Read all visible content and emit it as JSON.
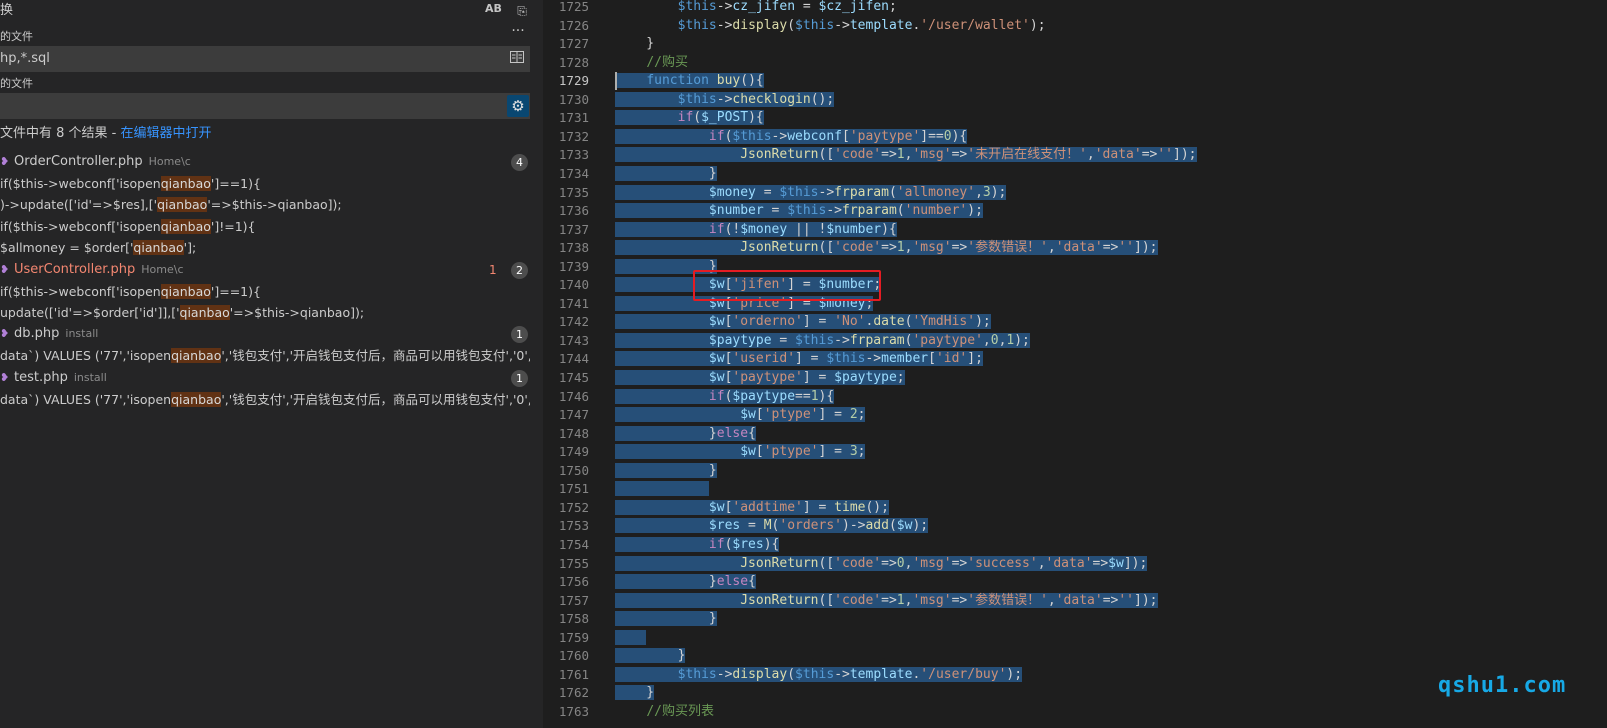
{
  "search": {
    "replace_label": "换",
    "replace_ab": "AB",
    "more": "···",
    "include_label": "的文件",
    "include_value": "hp,*.sql",
    "exclude_label": "的文件",
    "exclude_value": "",
    "summary_text": "文件中有 8 个结果 - ",
    "summary_link": "在编辑器中打开"
  },
  "results": [
    {
      "file": "OrderController.php",
      "path": "Home\\c",
      "count": "4",
      "error": false,
      "problems": "",
      "matches": [
        {
          "pre": "if($this->webconf['isopen",
          "hit": "qianbao",
          "post": "']==1){"
        },
        {
          "pre": ")->update(['id'=>$res],['",
          "hit": "qianbao",
          "post": "'=>$this->qianbao]);"
        },
        {
          "pre": "if($this->webconf['isopen",
          "hit": "qianbao",
          "post": "']!=1){"
        },
        {
          "pre": "$allmoney = $order['",
          "hit": "qianbao",
          "post": "'];"
        }
      ]
    },
    {
      "file": "UserController.php",
      "path": "Home\\c",
      "count": "2",
      "error": true,
      "problems": "1",
      "matches": [
        {
          "pre": "if($this->webconf['isopen",
          "hit": "qianbao",
          "post": "']==1){"
        },
        {
          "pre": "update(['id'=>$order['id']],['",
          "hit": "qianbao",
          "post": "'=>$this->qianbao]);"
        }
      ]
    },
    {
      "file": "db.php",
      "path": "install",
      "count": "1",
      "error": false,
      "problems": "",
      "matches": [
        {
          "pre": "data`) VALUES ('77','isopen",
          "hit": "qianbao",
          "post": "','钱包支付','开启钱包支付后，商品可以用钱包支付','0','1');"
        }
      ]
    },
    {
      "file": "test.php",
      "path": "install",
      "count": "1",
      "error": false,
      "problems": "",
      "matches": [
        {
          "pre": "data`) VALUES ('77','isopen",
          "hit": "qianbao",
          "post": "','钱包支付','开启钱包支付后，商品可以用钱包支付','0','1');"
        }
      ]
    }
  ],
  "editor": {
    "first_line": 1725,
    "active_line": 1729,
    "lines": [
      "        $this->cz_jifen = $cz_jifen;",
      "        $this->display($this->template.'/user/wallet');",
      "    }",
      "    //购买",
      "    function buy(){",
      "        $this->checklogin();",
      "        if($_POST){",
      "            if($this->webconf['paytype']==0){",
      "                JsonReturn(['code'=>1,'msg'=>'未开启在线支付！','data'=>'']);",
      "            }",
      "            $money = $this->frparam('allmoney',3);",
      "            $number = $this->frparam('number');",
      "            if(!$money || !$number){",
      "                JsonReturn(['code'=>1,'msg'=>'参数错误！','data'=>'']);",
      "            }",
      "            $w['jifen'] = $number;",
      "            $w['price'] = $money;",
      "            $w['orderno'] = 'No'.date('YmdHis');",
      "            $paytype = $this->frparam('paytype',0,1);",
      "            $w['userid'] = $this->member['id'];",
      "            $w['paytype'] = $paytype;",
      "            if($paytype==1){",
      "                $w['ptype'] = 2;",
      "            }else{",
      "                $w['ptype'] = 3;",
      "            }",
      "            ",
      "            $w['addtime'] = time();",
      "            $res = M('orders')->add($w);",
      "            if($res){",
      "                JsonReturn(['code'=>0,'msg'=>'success','data'=>$w]);",
      "            }else{",
      "                JsonReturn(['code'=>1,'msg'=>'参数错误！','data'=>'']);",
      "            }",
      "    ",
      "        }",
      "        $this->display($this->template.'/user/buy');",
      "    }",
      "    //购买列表"
    ]
  },
  "watermark": "qshu1.com"
}
